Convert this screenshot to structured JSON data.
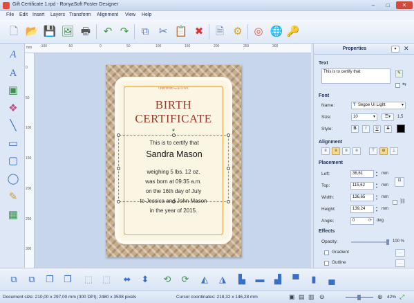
{
  "window": {
    "title": "Gift Certificate 1.rpd - RonyaSoft Poster Designer"
  },
  "menu": [
    "File",
    "Edit",
    "Insert",
    "Layers",
    "Transform",
    "Alignment",
    "View",
    "Help"
  ],
  "ruler": {
    "unit": "mm",
    "h_ticks": [
      "-100",
      "-50",
      "0",
      "50",
      "100",
      "150",
      "200",
      "250",
      "300"
    ],
    "v_ticks": [
      "0",
      "50",
      "100",
      "150",
      "200",
      "250",
      "300"
    ]
  },
  "certificate": {
    "small_heading": "CERTIFIED with LOVE",
    "heading_line1": "BIRTH",
    "heading_line2": "CERTIFICATE",
    "line1": "This is to certify that",
    "name": "Sandra Mason",
    "body": [
      "weighing 5 lbs. 12 oz.",
      "was born at 09:35 a.m.",
      "on the 16th day of July",
      "to Jessica and John Mason",
      "in the year of 2015."
    ]
  },
  "properties": {
    "title": "Properties",
    "text_section": "Text",
    "text_value": "This is to certify that",
    "font_section": "Font",
    "name_label": "Name:",
    "font_name": "Segoe UI Light",
    "size_label": "Size:",
    "font_size": "10",
    "line_spacing": "1,5",
    "style_label": "Style:",
    "style_buttons": [
      "B",
      "I",
      "U",
      "S"
    ],
    "text_color": "#000000",
    "alignment_section": "Alignment",
    "placement_section": "Placement",
    "left_label": "Left:",
    "left_value": "36,61",
    "top_label": "Top:",
    "top_value": "115,62",
    "width_label": "Width:",
    "width_value": "136,65",
    "height_label": "Height:",
    "height_value": "139,24",
    "unit_mm": "mm",
    "angle_label": "Angle:",
    "angle_value": "0",
    "angle_unit": "deg.",
    "effects_section": "Effects",
    "opacity_label": "Opacity:",
    "opacity_value": "100 %",
    "gradient_label": "Gradient",
    "outline_label": "Outline"
  },
  "status": {
    "document_size": "Document size: 210,00 x 297,00 mm (300 DPI); 2480 x 3508 pixels",
    "cursor": "Cursor coordinates: 218,32 x 146,28 mm",
    "zoom": "42%"
  },
  "colors": {
    "accent": "#3a6fc4",
    "close": "#d24a3d",
    "heading": "#9b3a26",
    "frame": "#e3a243"
  }
}
